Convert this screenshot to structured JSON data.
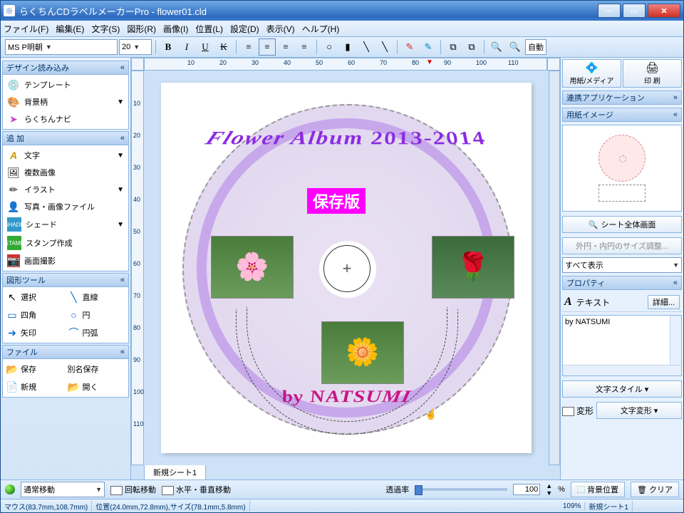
{
  "app": {
    "title": "らくちんCDラベルメーカーPro - flower01.cld"
  },
  "menu": [
    "ファイル(F)",
    "編集(E)",
    "文字(S)",
    "図形(R)",
    "画像(I)",
    "位置(L)",
    "設定(D)",
    "表示(V)",
    "ヘルプ(H)"
  ],
  "toolbar": {
    "font": "MS P明朝",
    "size": "20",
    "autofit": "自動"
  },
  "left": {
    "design": {
      "title": "デザイン読み込み",
      "items": [
        "テンプレート",
        "背景柄",
        "らくちんナビ"
      ]
    },
    "add": {
      "title": "追 加",
      "items": [
        "文字",
        "複数画像",
        "イラスト",
        "写真・画像ファイル",
        "シェード",
        "スタンプ作成",
        "画面撮影"
      ]
    },
    "tools": {
      "title": "図形ツール",
      "items": [
        "選択",
        "直線",
        "四角",
        "円",
        "矢印",
        "円弧"
      ]
    },
    "file": {
      "title": "ファイル",
      "items": [
        "保存",
        "別名保存",
        "新規",
        "開く"
      ]
    }
  },
  "canvas": {
    "arcTop": "Flower Album 2013-2014",
    "badge": "保存版",
    "arcBot": "by NATSUMI",
    "tab": "新規シート1"
  },
  "ruler": {
    "h": [
      "10",
      "20",
      "30",
      "40",
      "50",
      "60",
      "70",
      "80",
      "90",
      "100",
      "110"
    ],
    "v": [
      "10",
      "20",
      "30",
      "40",
      "50",
      "60",
      "70",
      "80",
      "90",
      "100",
      "110"
    ]
  },
  "right": {
    "paperMedia": "用紙/メディア",
    "print": "印 刷",
    "linkApps": "連携アプリケーション",
    "paperImage": "用紙イメージ",
    "wholeSheet": "シート全体画面",
    "circleAdjust": "外円・内円のサイズ調整...",
    "showAll": "すべて表示",
    "property": "プロパティ",
    "textLabel": "テキスト",
    "detail": "詳細...",
    "propText": "by NATSUMI",
    "textStyle": "文字スタイル",
    "deform": "変形",
    "textDeform": "文字変形"
  },
  "bottom": {
    "mode": "通常移動",
    "rotMove": "回転移動",
    "hvMove": "水平・垂直移動",
    "opacity": "透過率",
    "opacityVal": "100",
    "pct": "%",
    "bgPos": "背景位置",
    "clear": "クリア"
  },
  "status": {
    "mouse": "マウス(83.7mm,108.7mm)",
    "pos": "位置(24.0mm,72.8mm),サイズ(78.1mm,5.8mm)",
    "zoom": "109%",
    "sheet": "新規シート1"
  }
}
